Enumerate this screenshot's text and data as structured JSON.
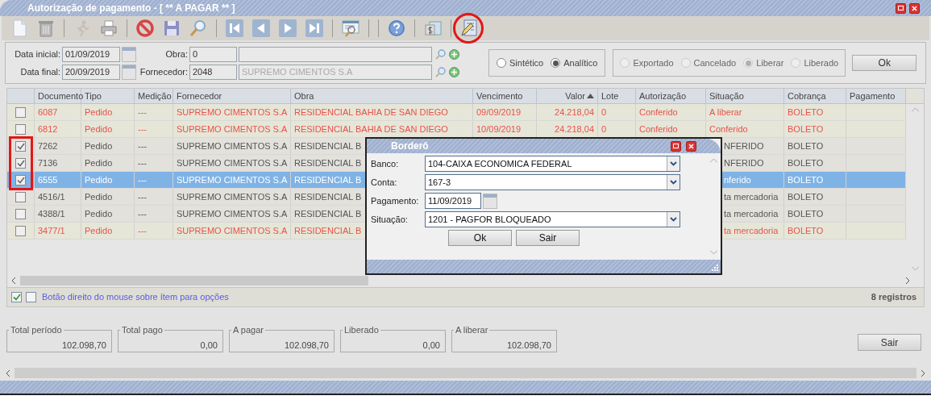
{
  "window": {
    "title": "Autorização de pagamento - [ ** A PAGAR ** ]"
  },
  "toolbar": [
    {
      "kind": "new",
      "disabled": false
    },
    {
      "kind": "delete",
      "disabled": false
    },
    {
      "kind": "separator"
    },
    {
      "kind": "run",
      "disabled": true
    },
    {
      "kind": "print",
      "disabled": false
    },
    {
      "kind": "separator"
    },
    {
      "kind": "cancel",
      "disabled": false
    },
    {
      "kind": "save",
      "disabled": false
    },
    {
      "kind": "search",
      "disabled": false
    },
    {
      "kind": "separator"
    },
    {
      "kind": "first",
      "disabled": false
    },
    {
      "kind": "prev",
      "disabled": false
    },
    {
      "kind": "next",
      "disabled": false
    },
    {
      "kind": "last",
      "disabled": false
    },
    {
      "kind": "separator"
    },
    {
      "kind": "report",
      "disabled": false
    },
    {
      "kind": "separator"
    },
    {
      "kind": "separator"
    },
    {
      "kind": "help",
      "disabled": false
    },
    {
      "kind": "separator"
    },
    {
      "kind": "money",
      "disabled": false
    },
    {
      "kind": "separator"
    },
    {
      "kind": "calculator",
      "disabled": false
    }
  ],
  "filters": {
    "data_inicial": {
      "label": "Data inicial:",
      "value": "01/09/2019"
    },
    "data_final": {
      "label": "Data final:",
      "value": "20/09/2019"
    },
    "obra": {
      "label": "Obra:",
      "code": "0"
    },
    "fornecedor": {
      "label": "Fornecedor:",
      "code": "2048",
      "name": "SUPREMO CIMENTOS S.A"
    }
  },
  "view_mode": [
    {
      "label": "Sintético",
      "selected": false
    },
    {
      "label": "Analítico",
      "selected": true
    }
  ],
  "status_filter": {
    "disabled": true,
    "options": [
      {
        "label": "Exportado",
        "selected": false
      },
      {
        "label": "Cancelado",
        "selected": false
      },
      {
        "label": "Liberar",
        "selected": true
      },
      {
        "label": "Liberado",
        "selected": false
      }
    ]
  },
  "ok_button": "Ok",
  "table": {
    "columns": [
      {
        "label": "Documento"
      },
      {
        "label": "Tipo"
      },
      {
        "label": "Medição"
      },
      {
        "label": "Fornecedor"
      },
      {
        "label": "Obra"
      },
      {
        "label": "Vencimento"
      },
      {
        "label": "Valor",
        "sorted": true
      },
      {
        "label": "Lote"
      },
      {
        "label": "Autorização"
      },
      {
        "label": "Situação"
      },
      {
        "label": "Cobrança"
      },
      {
        "label": "Pagamento"
      }
    ],
    "rows": [
      {
        "checked": false,
        "selected": false,
        "color": "#e8524a",
        "documento": "6087",
        "tipo": "Pedido",
        "medicao": "---",
        "fornecedor": "SUPREMO CIMENTOS S.A",
        "obra": "RESIDENCIAL BAHIA DE SAN DIEGO",
        "vencimento": "09/09/2019",
        "valor": "24.218,04",
        "lote": "0",
        "autorizacao": "Conferido",
        "situacao": "A liberar",
        "cobranca": "BOLETO"
      },
      {
        "checked": false,
        "selected": false,
        "color": "#e8524a",
        "documento": "6812",
        "tipo": "Pedido",
        "medicao": "---",
        "fornecedor": "SUPREMO CIMENTOS S.A",
        "obra": "RESIDENCIAL BAHIA DE SAN DIEGO",
        "vencimento": "10/09/2019",
        "valor": "24.218,04",
        "lote": "0",
        "autorizacao": "Conferido",
        "situacao": "Conferido",
        "cobranca": "BOLETO"
      },
      {
        "checked": true,
        "selected": false,
        "color": "#555555",
        "documento": "7262",
        "tipo": "Pedido",
        "medicao": "---",
        "fornecedor": "SUPREMO CIMENTOS S.A",
        "obra": "RESIDENCIAL B",
        "situacao": "NFERIDO",
        "cobranca": "BOLETO"
      },
      {
        "checked": true,
        "selected": false,
        "color": "#555555",
        "documento": "7136",
        "tipo": "Pedido",
        "medicao": "---",
        "fornecedor": "SUPREMO CIMENTOS S.A",
        "obra": "RESIDENCIAL B",
        "situacao": "NFERIDO",
        "cobranca": "BOLETO"
      },
      {
        "checked": true,
        "selected": true,
        "documento": "6555",
        "tipo": "Pedido",
        "medicao": "---",
        "fornecedor": "SUPREMO CIMENTOS S.A",
        "obra": "RESIDENCIAL B",
        "situacao": "nferido",
        "cobranca": "BOLETO"
      },
      {
        "checked": false,
        "selected": false,
        "color": "#555555",
        "documento": "4516/1",
        "tipo": "Pedido",
        "medicao": "---",
        "fornecedor": "SUPREMO CIMENTOS S.A",
        "obra": "RESIDENCIAL B",
        "situacao": "ta mercadoria",
        "cobranca": "BOLETO"
      },
      {
        "checked": false,
        "selected": false,
        "color": "#555555",
        "documento": "4388/1",
        "tipo": "Pedido",
        "medicao": "---",
        "fornecedor": "SUPREMO CIMENTOS S.A",
        "obra": "RESIDENCIAL B",
        "situacao": "ta mercadoria",
        "cobranca": "BOLETO"
      },
      {
        "checked": false,
        "selected": false,
        "color": "#e8524a",
        "documento": "3477/1",
        "tipo": "Pedido",
        "medicao": "---",
        "fornecedor": "SUPREMO CIMENTOS S.A",
        "obra": "RESIDENCIAL B",
        "situacao": "ta mercadoria",
        "cobranca": "BOLETO"
      }
    ]
  },
  "status_bar": {
    "checkboxes": [
      {
        "checked": true
      },
      {
        "checked": false
      }
    ],
    "hint": "Botão direito do mouse sobre ítem para opções",
    "count": "8 registros"
  },
  "totals": [
    {
      "label": "Total período",
      "value": "102.098,70"
    },
    {
      "label": "Total pago",
      "value": "0,00"
    },
    {
      "label": "A pagar",
      "value": "102.098,70"
    },
    {
      "label": "Liberado",
      "value": "0,00"
    },
    {
      "label": "A liberar",
      "value": "102.098,70"
    }
  ],
  "exit_button": "Sair",
  "dialog": {
    "title": "Borderô",
    "fields": [
      {
        "kind": "select",
        "label": "Banco:",
        "value": "104-CAIXA ECONOMICA FEDERAL"
      },
      {
        "kind": "select",
        "label": "Conta:",
        "value": "167-3"
      },
      {
        "kind": "date",
        "label": "Pagamento:",
        "value": "11/09/2019"
      },
      {
        "kind": "select",
        "label": "Situação:",
        "value": "1201 - PAGFOR BLOQUEADO"
      }
    ],
    "buttons": [
      "Ok",
      "Sair"
    ]
  },
  "annotations": {
    "circled_tool": true,
    "boxed_checkboxes": true
  }
}
